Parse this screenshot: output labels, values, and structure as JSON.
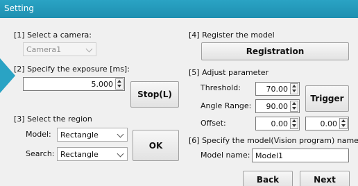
{
  "window": {
    "title": "Setting"
  },
  "camera": {
    "heading": "[1] Select a camera:",
    "value": "Camera1"
  },
  "exposure": {
    "heading": "[2] Specify the exposure [ms]:",
    "value": "5.000"
  },
  "stop_label": "Stop(L)",
  "region": {
    "heading": "[3] Select the region",
    "model_label": "Model:",
    "model_value": "Rectangle",
    "search_label": "Search:",
    "search_value": "Rectangle"
  },
  "ok_label": "OK",
  "register": {
    "heading": "[4] Register the model",
    "button_label": "Registration"
  },
  "adjust": {
    "heading": "[5] Adjust parameter",
    "threshold_label": "Threshold:",
    "threshold_value": "70.00",
    "angle_label": "Angle Range:",
    "angle_value": "90.00",
    "offset_label": "Offset:",
    "offset_value_1": "0.00",
    "offset_value_2": "0.00"
  },
  "trigger_label": "Trigger",
  "name_section": {
    "heading": "[6] Specify the model(Vision program) name",
    "label": "Model name:",
    "value": "Model1"
  },
  "back_label": "Back",
  "next_label": "Next",
  "colors": {
    "titlebar": "#2aa3c4",
    "window": "#f0f0f0"
  }
}
